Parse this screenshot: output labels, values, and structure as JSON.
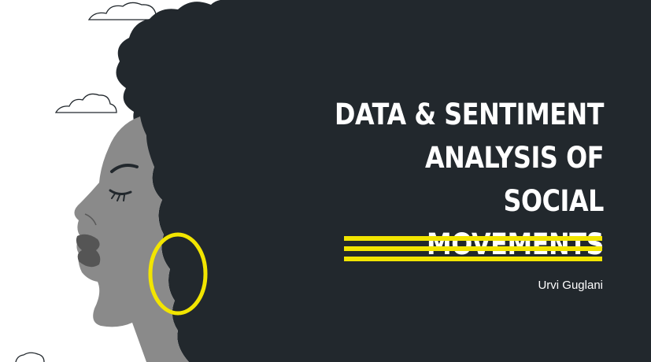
{
  "slide": {
    "title_lines": [
      "DATA & SENTIMENT",
      "ANALYSIS OF SOCIAL",
      "MOVEMENTS"
    ],
    "author": "Urvi Guglani"
  },
  "colors": {
    "background": "#ffffff",
    "hair": "#22282d",
    "skin": "#8a8a8a",
    "lips": "#5e5e5e",
    "accent_yellow": "#f2e500",
    "text": "#ffffff"
  },
  "illustration": {
    "description_icons": [
      "cloud-icon",
      "hoop-earring-icon"
    ]
  }
}
